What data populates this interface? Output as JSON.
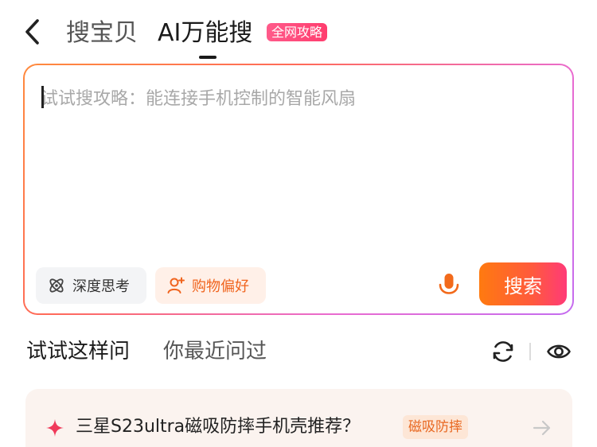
{
  "header": {
    "tabs": [
      {
        "label": "搜宝贝"
      },
      {
        "label": "AI万能搜"
      }
    ],
    "badge": "全网攻略"
  },
  "search": {
    "placeholder": "试试搜攻略：能连接手机控制的智能风扇",
    "value": "",
    "chips": [
      {
        "label": "深度思考",
        "icon": "atom-icon"
      },
      {
        "label": "购物偏好",
        "icon": "user-plus-icon"
      }
    ],
    "mic_icon": "microphone-icon",
    "button_label": "搜索"
  },
  "suggestions_section": {
    "tabs": [
      {
        "label": "试试这样问"
      },
      {
        "label": "你最近问过"
      }
    ],
    "items": [
      {
        "text": "三星S23ultra磁吸防摔手机壳推荐？",
        "tag": "磁吸防摔"
      }
    ]
  },
  "colors": {
    "accent_orange": "#ff6a1a",
    "accent_pink": "#ff3a78",
    "badge_pink": "#ff4d7c"
  }
}
